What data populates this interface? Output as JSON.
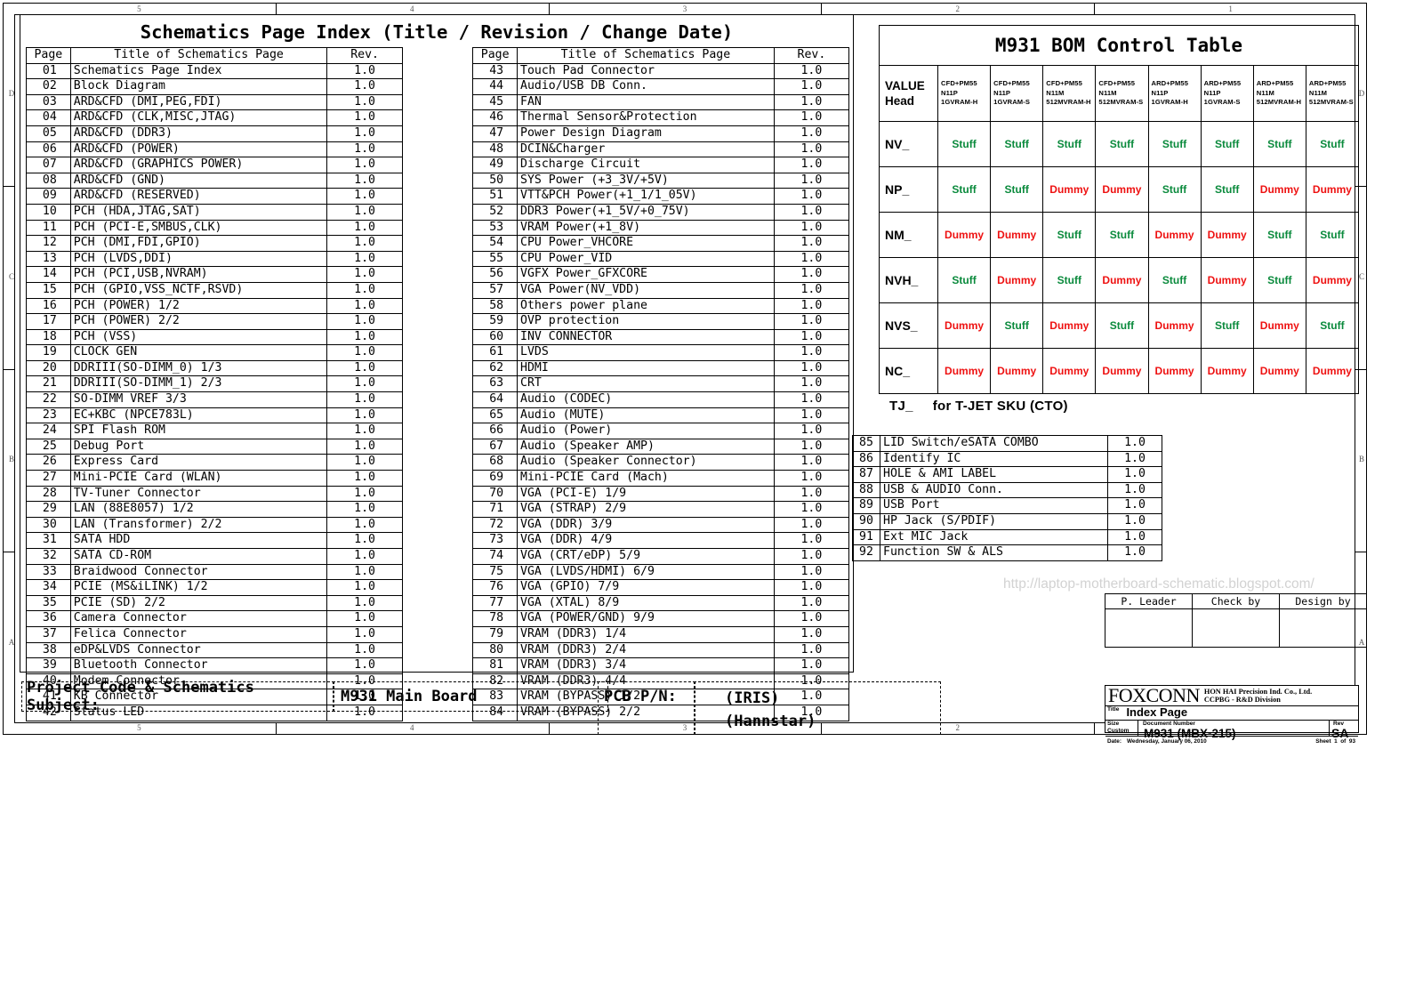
{
  "sheet": {
    "zone_numbers": [
      "5",
      "4",
      "3",
      "2",
      "1"
    ],
    "zone_letters_right": [
      "D",
      "C",
      "B",
      "A"
    ],
    "zone_letters_left": [
      "D",
      "C",
      "B",
      "A"
    ]
  },
  "index": {
    "title": "Schematics Page Index (Title / Revision / Change Date)",
    "headers": {
      "page": "Page",
      "title": "Title of Schematics Page",
      "rev": "Rev."
    },
    "left_rows": [
      {
        "page": "01",
        "title": "Schematics Page Index",
        "rev": "1.0"
      },
      {
        "page": "02",
        "title": "Block Diagram",
        "rev": "1.0"
      },
      {
        "page": "03",
        "title": "ARD&CFD (DMI,PEG,FDI)",
        "rev": "1.0"
      },
      {
        "page": "04",
        "title": "ARD&CFD (CLK,MISC,JTAG)",
        "rev": "1.0"
      },
      {
        "page": "05",
        "title": "ARD&CFD (DDR3)",
        "rev": "1.0"
      },
      {
        "page": "06",
        "title": "ARD&CFD (POWER)",
        "rev": "1.0"
      },
      {
        "page": "07",
        "title": "ARD&CFD (GRAPHICS POWER)",
        "rev": "1.0"
      },
      {
        "page": "08",
        "title": "ARD&CFD (GND)",
        "rev": "1.0"
      },
      {
        "page": "09",
        "title": "ARD&CFD (RESERVED)",
        "rev": "1.0"
      },
      {
        "page": "10",
        "title": "PCH (HDA,JTAG,SAT)",
        "rev": "1.0"
      },
      {
        "page": "11",
        "title": "PCH (PCI-E,SMBUS,CLK)",
        "rev": "1.0"
      },
      {
        "page": "12",
        "title": "PCH (DMI,FDI,GPIO)",
        "rev": "1.0"
      },
      {
        "page": "13",
        "title": "PCH (LVDS,DDI)",
        "rev": "1.0"
      },
      {
        "page": "14",
        "title": "PCH (PCI,USB,NVRAM)",
        "rev": "1.0"
      },
      {
        "page": "15",
        "title": "PCH (GPIO,VSS_NCTF,RSVD)",
        "rev": "1.0"
      },
      {
        "page": "16",
        "title": "PCH (POWER) 1/2",
        "rev": "1.0"
      },
      {
        "page": "17",
        "title": "PCH (POWER) 2/2",
        "rev": "1.0"
      },
      {
        "page": "18",
        "title": "PCH (VSS)",
        "rev": "1.0"
      },
      {
        "page": "19",
        "title": "CLOCK GEN",
        "rev": "1.0"
      },
      {
        "page": "20",
        "title": "DDRIII(SO-DIMM_0) 1/3",
        "rev": "1.0"
      },
      {
        "page": "21",
        "title": "DDRIII(SO-DIMM_1) 2/3",
        "rev": "1.0"
      },
      {
        "page": "22",
        "title": "SO-DIMM VREF 3/3",
        "rev": "1.0"
      },
      {
        "page": "23",
        "title": "EC+KBC (NPCE783L)",
        "rev": "1.0"
      },
      {
        "page": "24",
        "title": "SPI Flash ROM",
        "rev": "1.0"
      },
      {
        "page": "25",
        "title": "Debug Port",
        "rev": "1.0"
      },
      {
        "page": "26",
        "title": "Express Card",
        "rev": "1.0"
      },
      {
        "page": "27",
        "title": "Mini-PCIE Card (WLAN)",
        "rev": "1.0"
      },
      {
        "page": "28",
        "title": "TV-Tuner Connector",
        "rev": "1.0"
      },
      {
        "page": "29",
        "title": "LAN (88E8057) 1/2",
        "rev": "1.0"
      },
      {
        "page": "30",
        "title": "LAN (Transformer) 2/2",
        "rev": "1.0"
      },
      {
        "page": "31",
        "title": "SATA HDD",
        "rev": "1.0"
      },
      {
        "page": "32",
        "title": "SATA CD-ROM",
        "rev": "1.0"
      },
      {
        "page": "33",
        "title": "Braidwood Connector",
        "rev": "1.0"
      },
      {
        "page": "34",
        "title": "PCIE (MS&iLINK) 1/2",
        "rev": "1.0"
      },
      {
        "page": "35",
        "title": "PCIE (SD) 2/2",
        "rev": "1.0"
      },
      {
        "page": "36",
        "title": "Camera Connector",
        "rev": "1.0"
      },
      {
        "page": "37",
        "title": "Felica Connector",
        "rev": "1.0"
      },
      {
        "page": "38",
        "title": "eDP&LVDS Connector",
        "rev": "1.0"
      },
      {
        "page": "39",
        "title": "Bluetooth Connector",
        "rev": "1.0"
      },
      {
        "page": "40",
        "title": "Modem Connector",
        "rev": "1.0"
      },
      {
        "page": "41",
        "title": "KB Connector",
        "rev": "1.0"
      },
      {
        "page": "42",
        "title": "Status LED",
        "rev": "1.0"
      }
    ],
    "right_rows": [
      {
        "page": "43",
        "title": "Touch Pad Connector",
        "rev": "1.0"
      },
      {
        "page": "44",
        "title": "Audio/USB DB Conn.",
        "rev": "1.0"
      },
      {
        "page": "45",
        "title": "FAN",
        "rev": "1.0"
      },
      {
        "page": "46",
        "title": "Thermal Sensor&Protection",
        "rev": "1.0"
      },
      {
        "page": "47",
        "title": "Power Design Diagram",
        "rev": "1.0"
      },
      {
        "page": "48",
        "title": "DCIN&Charger",
        "rev": "1.0"
      },
      {
        "page": "49",
        "title": "Discharge Circuit",
        "rev": "1.0"
      },
      {
        "page": "50",
        "title": "SYS Power (+3_3V/+5V)",
        "rev": "1.0"
      },
      {
        "page": "51",
        "title": "VTT&PCH Power(+1_1/1_05V)",
        "rev": "1.0"
      },
      {
        "page": "52",
        "title": "DDR3 Power(+1_5V/+0_75V)",
        "rev": "1.0"
      },
      {
        "page": "53",
        "title": "VRAM Power(+1_8V)",
        "rev": "1.0"
      },
      {
        "page": "54",
        "title": "CPU Power_VHCORE",
        "rev": "1.0"
      },
      {
        "page": "55",
        "title": "CPU Power_VID",
        "rev": "1.0"
      },
      {
        "page": "56",
        "title": "VGFX Power_GFXCORE",
        "rev": "1.0"
      },
      {
        "page": "57",
        "title": "VGA  Power(NV_VDD)",
        "rev": "1.0"
      },
      {
        "page": "58",
        "title": "Others power plane",
        "rev": "1.0"
      },
      {
        "page": "59",
        "title": "OVP protection",
        "rev": "1.0"
      },
      {
        "page": "60",
        "title": "INV CONNECTOR",
        "rev": "1.0"
      },
      {
        "page": "61",
        "title": "LVDS",
        "rev": "1.0"
      },
      {
        "page": "62",
        "title": "HDMI",
        "rev": "1.0"
      },
      {
        "page": "63",
        "title": "CRT",
        "rev": "1.0"
      },
      {
        "page": "64",
        "title": "Audio (CODEC)",
        "rev": "1.0"
      },
      {
        "page": "65",
        "title": "Audio (MUTE)",
        "rev": "1.0"
      },
      {
        "page": "66",
        "title": "Audio (Power)",
        "rev": "1.0"
      },
      {
        "page": "67",
        "title": "Audio (Speaker AMP)",
        "rev": "1.0"
      },
      {
        "page": "68",
        "title": "Audio (Speaker Connector)",
        "rev": "1.0"
      },
      {
        "page": "69",
        "title": "Mini-PCIE Card (Mach)",
        "rev": "1.0"
      },
      {
        "page": "70",
        "title": "VGA (PCI-E) 1/9",
        "rev": "1.0"
      },
      {
        "page": "71",
        "title": "VGA (STRAP) 2/9",
        "rev": "1.0"
      },
      {
        "page": "72",
        "title": "VGA (DDR) 3/9",
        "rev": "1.0"
      },
      {
        "page": "73",
        "title": "VGA (DDR) 4/9",
        "rev": "1.0"
      },
      {
        "page": "74",
        "title": "VGA (CRT/eDP) 5/9",
        "rev": "1.0"
      },
      {
        "page": "75",
        "title": "VGA (LVDS/HDMI) 6/9",
        "rev": "1.0"
      },
      {
        "page": "76",
        "title": "VGA (GPIO) 7/9",
        "rev": "1.0"
      },
      {
        "page": "77",
        "title": "VGA (XTAL) 8/9",
        "rev": "1.0"
      },
      {
        "page": "78",
        "title": "VGA (POWER/GND) 9/9",
        "rev": "1.0"
      },
      {
        "page": "79",
        "title": "VRAM (DDR3) 1/4",
        "rev": "1.0"
      },
      {
        "page": "80",
        "title": "VRAM (DDR3) 2/4",
        "rev": "1.0"
      },
      {
        "page": "81",
        "title": "VRAM (DDR3) 3/4",
        "rev": "1.0"
      },
      {
        "page": "82",
        "title": "VRAM (DDR3) 4/4",
        "rev": "1.0"
      },
      {
        "page": "83",
        "title": "VRAM (BYPASS) 1/2",
        "rev": "1.0"
      },
      {
        "page": "84",
        "title": "VRAM (BYPASS) 2/2",
        "rev": "1.0"
      }
    ]
  },
  "extra_pages": [
    {
      "page": "85",
      "title": "LID Switch/eSATA COMBO",
      "rev": "1.0"
    },
    {
      "page": "86",
      "title": "Identify IC",
      "rev": "1.0"
    },
    {
      "page": "87",
      "title": "HOLE & AMI LABEL",
      "rev": "1.0"
    },
    {
      "page": "88",
      "title": "USB & AUDIO Conn.",
      "rev": "1.0"
    },
    {
      "page": "89",
      "title": "USB Port",
      "rev": "1.0"
    },
    {
      "page": "90",
      "title": "HP Jack (S/PDIF)",
      "rev": "1.0"
    },
    {
      "page": "91",
      "title": "Ext MIC Jack",
      "rev": "1.0"
    },
    {
      "page": "92",
      "title": "Function SW & ALS",
      "rev": "1.0"
    }
  ],
  "bom": {
    "title": "M931 BOM Control Table",
    "value_head_label_line1": "VALUE",
    "value_head_label_line2": "Head",
    "columns": [
      {
        "l1": "CFD+PM55",
        "l2": "N11P",
        "l3": "1GVRAM-H"
      },
      {
        "l1": "CFD+PM55",
        "l2": "N11P",
        "l3": "1GVRAM-S"
      },
      {
        "l1": "CFD+PM55",
        "l2": "N11M",
        "l3": "512MVRAM-H"
      },
      {
        "l1": "CFD+PM55",
        "l2": "N11M",
        "l3": "512MVRAM-S"
      },
      {
        "l1": "ARD+PM55",
        "l2": "N11P",
        "l3": "1GVRAM-H"
      },
      {
        "l1": "ARD+PM55",
        "l2": "N11P",
        "l3": "1GVRAM-S"
      },
      {
        "l1": "ARD+PM55",
        "l2": "N11M",
        "l3": "512MVRAM-H"
      },
      {
        "l1": "ARD+PM55",
        "l2": "N11M",
        "l3": "512MVRAM-S"
      }
    ],
    "rows": [
      {
        "head": "NV_",
        "cells": [
          "Stuff",
          "Stuff",
          "Stuff",
          "Stuff",
          "Stuff",
          "Stuff",
          "Stuff",
          "Stuff"
        ]
      },
      {
        "head": "NP_",
        "cells": [
          "Stuff",
          "Stuff",
          "Dummy",
          "Dummy",
          "Stuff",
          "Stuff",
          "Dummy",
          "Dummy"
        ]
      },
      {
        "head": "NM_",
        "cells": [
          "Dummy",
          "Dummy",
          "Stuff",
          "Stuff",
          "Dummy",
          "Dummy",
          "Stuff",
          "Stuff"
        ]
      },
      {
        "head": "NVH_",
        "cells": [
          "Stuff",
          "Dummy",
          "Stuff",
          "Dummy",
          "Stuff",
          "Dummy",
          "Stuff",
          "Dummy"
        ]
      },
      {
        "head": "NVS_",
        "cells": [
          "Dummy",
          "Stuff",
          "Dummy",
          "Stuff",
          "Dummy",
          "Stuff",
          "Dummy",
          "Stuff"
        ]
      },
      {
        "head": "NC_",
        "cells": [
          "Dummy",
          "Dummy",
          "Dummy",
          "Dummy",
          "Dummy",
          "Dummy",
          "Dummy",
          "Dummy"
        ]
      }
    ],
    "note_label": "TJ_",
    "note_text": "for T-JET SKU (CTO)",
    "colors": {
      "stuff": "#0a8a3c",
      "dummy": "#ee1111"
    }
  },
  "watermark": "http://laptop-motherboard-schematic.blogspot.com/",
  "approvals": {
    "headers": [
      "P. Leader",
      "Check by",
      "Design by"
    ]
  },
  "title_block": {
    "logo": "FOXCONN",
    "company_line1": "HON HAI Precision Ind. Co., Ltd.",
    "company_line2": "CCPBG - R&D Division",
    "title_label": "Title",
    "title_value": "Index Page",
    "size_label": "Size",
    "size_value": "Custom",
    "doc_label": "Document Number",
    "doc_value": "M931 (MBX-215)",
    "rev_label": "Rev",
    "rev_value": "SA",
    "date_label": "Date:",
    "date_value": "Wednesday, January 06, 2010",
    "sheet_label": "Sheet",
    "sheet_num": "1",
    "sheet_of": "of",
    "sheet_total": "93"
  },
  "bottom": {
    "project_label": "Project Code & Schematics Subject:",
    "project_value": "M931 Main Board",
    "pcb_label": "PCB P/N:",
    "pcb_value_line1": "(IRIS)",
    "pcb_value_line2": "(Hannstar)"
  }
}
